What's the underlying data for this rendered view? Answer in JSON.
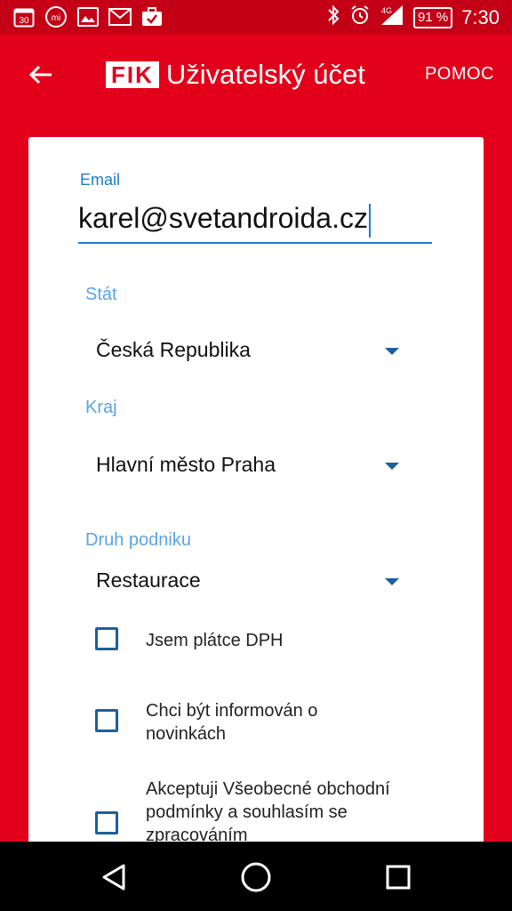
{
  "status_bar": {
    "left_icons": [
      "calendar-icon",
      "mi-icon",
      "image-icon",
      "gmail-icon",
      "briefcase-check-icon"
    ],
    "calendar_day": "30",
    "mi_label": "mi",
    "battery": "91 %",
    "time": "7:30"
  },
  "app_bar": {
    "logo": "FIK",
    "title": "Uživatelský účet",
    "help_label": "POMOC"
  },
  "form": {
    "email_label": "Email",
    "email_value": "karel@svetandroida.cz",
    "country_label": "Stát",
    "country_value": "Česká Republika",
    "region_label": "Kraj",
    "region_value": "Hlavní město Praha",
    "business_label": "Druh podniku",
    "business_value": "Restaurace",
    "checkbox_vat": "Jsem plátce DPH",
    "checkbox_news": "Chci být informován o novinkách",
    "checkbox_terms": "Akceptuji Všeobecné obchodní podmínky a souhlasím se zpracováním"
  },
  "colors": {
    "primary": "#e2001a",
    "status_bar": "#c40016",
    "accent": "#1a7dc0",
    "label": "#5aa3e6"
  }
}
